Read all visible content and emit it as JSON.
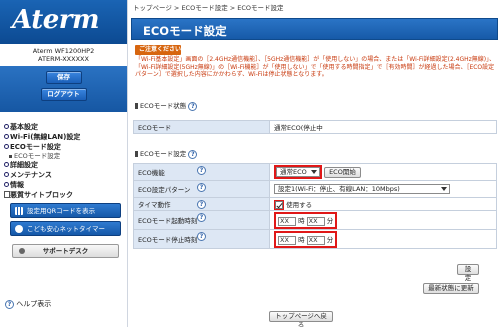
{
  "brand": {
    "logo_text": "Aterm"
  },
  "device": {
    "model": "Aterm WF1200HP2",
    "id": "ATERM-XXXXXX"
  },
  "sidebar": {
    "save_label": "保存",
    "logout_label": "ログアウト",
    "menu": [
      {
        "label": "基本設定"
      },
      {
        "label": "Wi-Fi(無線LAN)設定"
      },
      {
        "label": "ECOモード設定"
      },
      {
        "label": "ECOモード設定",
        "sub": true
      },
      {
        "label": "詳細設定"
      },
      {
        "label": "メンテナンス"
      },
      {
        "label": "情報"
      },
      {
        "label": "悪質サイトブロック"
      }
    ],
    "qr_button_label": "設定用QRコードを表示",
    "kids_timer_label": "こども安心ネットタイマー",
    "support_label": "サポートデスク",
    "help_label": "ヘルプ表示"
  },
  "breadcrumb": "トップページ > ECOモード設定 > ECOモード設定",
  "page_title": "ECOモード設定",
  "notice": {
    "badge": "ご注意ください",
    "text": "「Wi-Fi基本設定」画面の［2.4GHz通信機能］、［5GHz通信機能］が「使用しない」の場合、または「Wi-Fi詳細設定(2.4GHz無線)」、「Wi-Fi詳細設定(5GHz無線)」の［Wi-Fi機能］が「使用しない」で「使用する時間指定」で［有効時間］が経過した場合、［ECO設定パターン］で選択した内容にかかわらず、Wi-Fiは停止状態となります。"
  },
  "status_section": {
    "heading": "ECOモード状態",
    "help_icon_char": "?",
    "eco_mode_label": "ECOモード",
    "eco_mode_value": "通常ECO(停止中"
  },
  "settings_section": {
    "heading": "ECOモード設定",
    "rows": {
      "function_label": "ECO機能",
      "function_value": "通常ECO",
      "start_button": "ECO開始",
      "pattern_label": "ECO設定パターン",
      "pattern_value": "設定1(Wi-Fi：停止、有線LAN：10Mbps)",
      "timer_label": "タイマ動作",
      "timer_value": "使用する",
      "start_time_label": "ECOモード起動時刻",
      "stop_time_label": "ECOモード停止時刻",
      "hour_placeholder": "XX",
      "minute_placeholder": "XX",
      "hour_unit": "時",
      "minute_unit": "分"
    }
  },
  "buttons": {
    "set": "設定",
    "refresh": "最新状態に更新",
    "to_top": "トップページへ戻る"
  }
}
